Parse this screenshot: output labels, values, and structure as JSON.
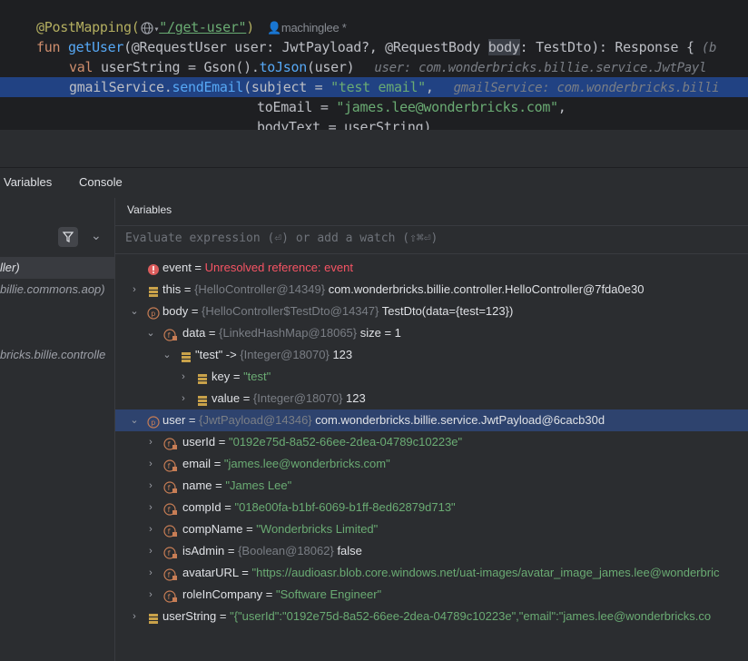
{
  "editor": {
    "line1": {
      "annotation": "@PostMapping(",
      "path": "\"/get-user\"",
      "close": ")",
      "author": "machinglee *"
    },
    "line2": {
      "kw": "fun ",
      "fn": "getUser",
      "rest1": "(@RequestUser user: JwtPayload?, @RequestBody ",
      "body": "body",
      "rest2": ": TestDto): Response {",
      "tail": " (b"
    },
    "line3": {
      "kw": "val ",
      "rest": "userString = Gson().",
      "fn": "toJson",
      "rest2": "(user)",
      "hint": "user: com.wonderbricks.billie.service.JwtPayl"
    },
    "line4": {
      "rest": "gmailService.",
      "fn": "sendEmail",
      "rest2": "(subject = ",
      "str": "\"test email\"",
      "rest3": ",",
      "hint": "gmailService: com.wonderbricks.billi"
    },
    "line5": {
      "rest": "toEmail = ",
      "str": "\"james.lee@wonderbricks.com\"",
      "rest2": ","
    },
    "line6": {
      "rest": "bodyText = userString)"
    }
  },
  "tabs": {
    "variables": "Variables",
    "console": "Console"
  },
  "frames": {
    "items": [
      "ller)",
      "billie.commons.aop)",
      "bricks.billie.controlle"
    ]
  },
  "variables": {
    "header": "Variables",
    "eval_placeholder": "Evaluate expression (⏎) or add a watch (⇧⌘⏎)",
    "rows": [
      {
        "name": "event",
        "eq": " = ",
        "ref": "",
        "value": "Unresolved reference: event",
        "vclass": "verr"
      },
      {
        "name": "this",
        "eq": " = ",
        "ref": "{HelloController@14349} ",
        "value": "com.wonderbricks.billie.controller.HelloController@7fda0e30",
        "vclass": "vnum"
      },
      {
        "name": "body",
        "eq": " = ",
        "ref": "{HelloController$TestDto@14347} ",
        "value": "TestDto(data={test=123})",
        "vclass": "vnum"
      },
      {
        "name": "data",
        "eq": " = ",
        "ref": "{LinkedHashMap@18065} ",
        "value": " size = 1",
        "vclass": "vnum"
      },
      {
        "name": "\"test\" -> ",
        "eq": "",
        "ref": "{Integer@18070} ",
        "value": "123",
        "vclass": "vnum"
      },
      {
        "name": "key",
        "eq": " = ",
        "ref": "",
        "value": "\"test\"",
        "vclass": "vstr"
      },
      {
        "name": "value",
        "eq": " = ",
        "ref": "{Integer@18070} ",
        "value": "123",
        "vclass": "vnum"
      },
      {
        "name": "user",
        "eq": " = ",
        "ref": "{JwtPayload@14346} ",
        "value": "com.wonderbricks.billie.service.JwtPayload@6cacb30d",
        "vclass": "vnum"
      },
      {
        "name": "userId",
        "eq": " = ",
        "ref": "",
        "value": "\"0192e75d-8a52-66ee-2dea-04789c10223e\"",
        "vclass": "vstr"
      },
      {
        "name": "email",
        "eq": " = ",
        "ref": "",
        "value": "\"james.lee@wonderbricks.com\"",
        "vclass": "vstr"
      },
      {
        "name": "name",
        "eq": " = ",
        "ref": "",
        "value": "\"James Lee\"",
        "vclass": "vstr"
      },
      {
        "name": "compId",
        "eq": " = ",
        "ref": "",
        "value": "\"018e00fa-b1bf-6069-b1ff-8ed62879d713\"",
        "vclass": "vstr"
      },
      {
        "name": "compName",
        "eq": " = ",
        "ref": "",
        "value": "\"Wonderbricks Limited\"",
        "vclass": "vstr"
      },
      {
        "name": "isAdmin",
        "eq": " = ",
        "ref": "{Boolean@18062} ",
        "value": "false",
        "vclass": "vnum"
      },
      {
        "name": "avatarURL",
        "eq": " = ",
        "ref": "",
        "value": "\"https://audioasr.blob.core.windows.net/uat-images/avatar_image_james.lee@wonderbric",
        "vclass": "vstr"
      },
      {
        "name": "roleInCompany",
        "eq": " = ",
        "ref": "",
        "value": "\"Software Engineer\"",
        "vclass": "vstr"
      },
      {
        "name": "userString",
        "eq": " = ",
        "ref": "",
        "value": "\"{\"userId\":\"0192e75d-8a52-66ee-2dea-04789c10223e\",\"email\":\"james.lee@wonderbricks.co",
        "vclass": "vstr"
      }
    ]
  }
}
